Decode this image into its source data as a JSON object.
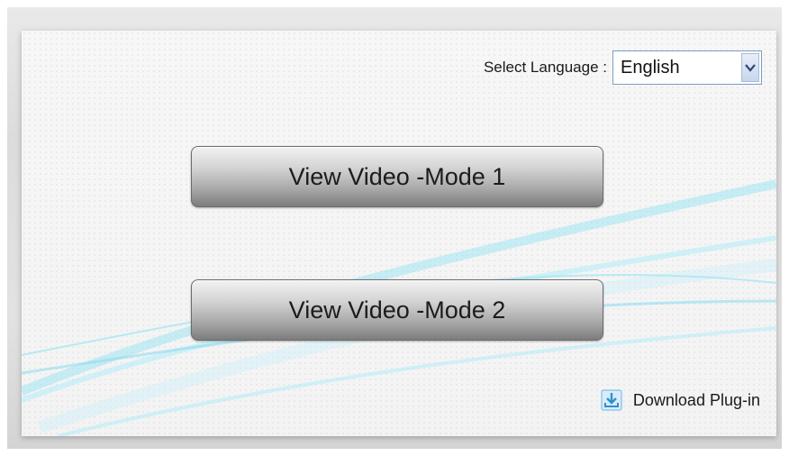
{
  "language": {
    "label": "Select Language :",
    "selected": "English"
  },
  "buttons": {
    "mode1": "View Video -Mode 1",
    "mode2": "View Video -Mode 2"
  },
  "download": {
    "label": "Download Plug-in"
  },
  "icons": {
    "dropdown": "chevron-down-icon",
    "download": "download-icon"
  },
  "colors": {
    "wave": "#8fdcef",
    "select_border": "#7a9cc6",
    "download_icon": "#3a9ad9"
  }
}
